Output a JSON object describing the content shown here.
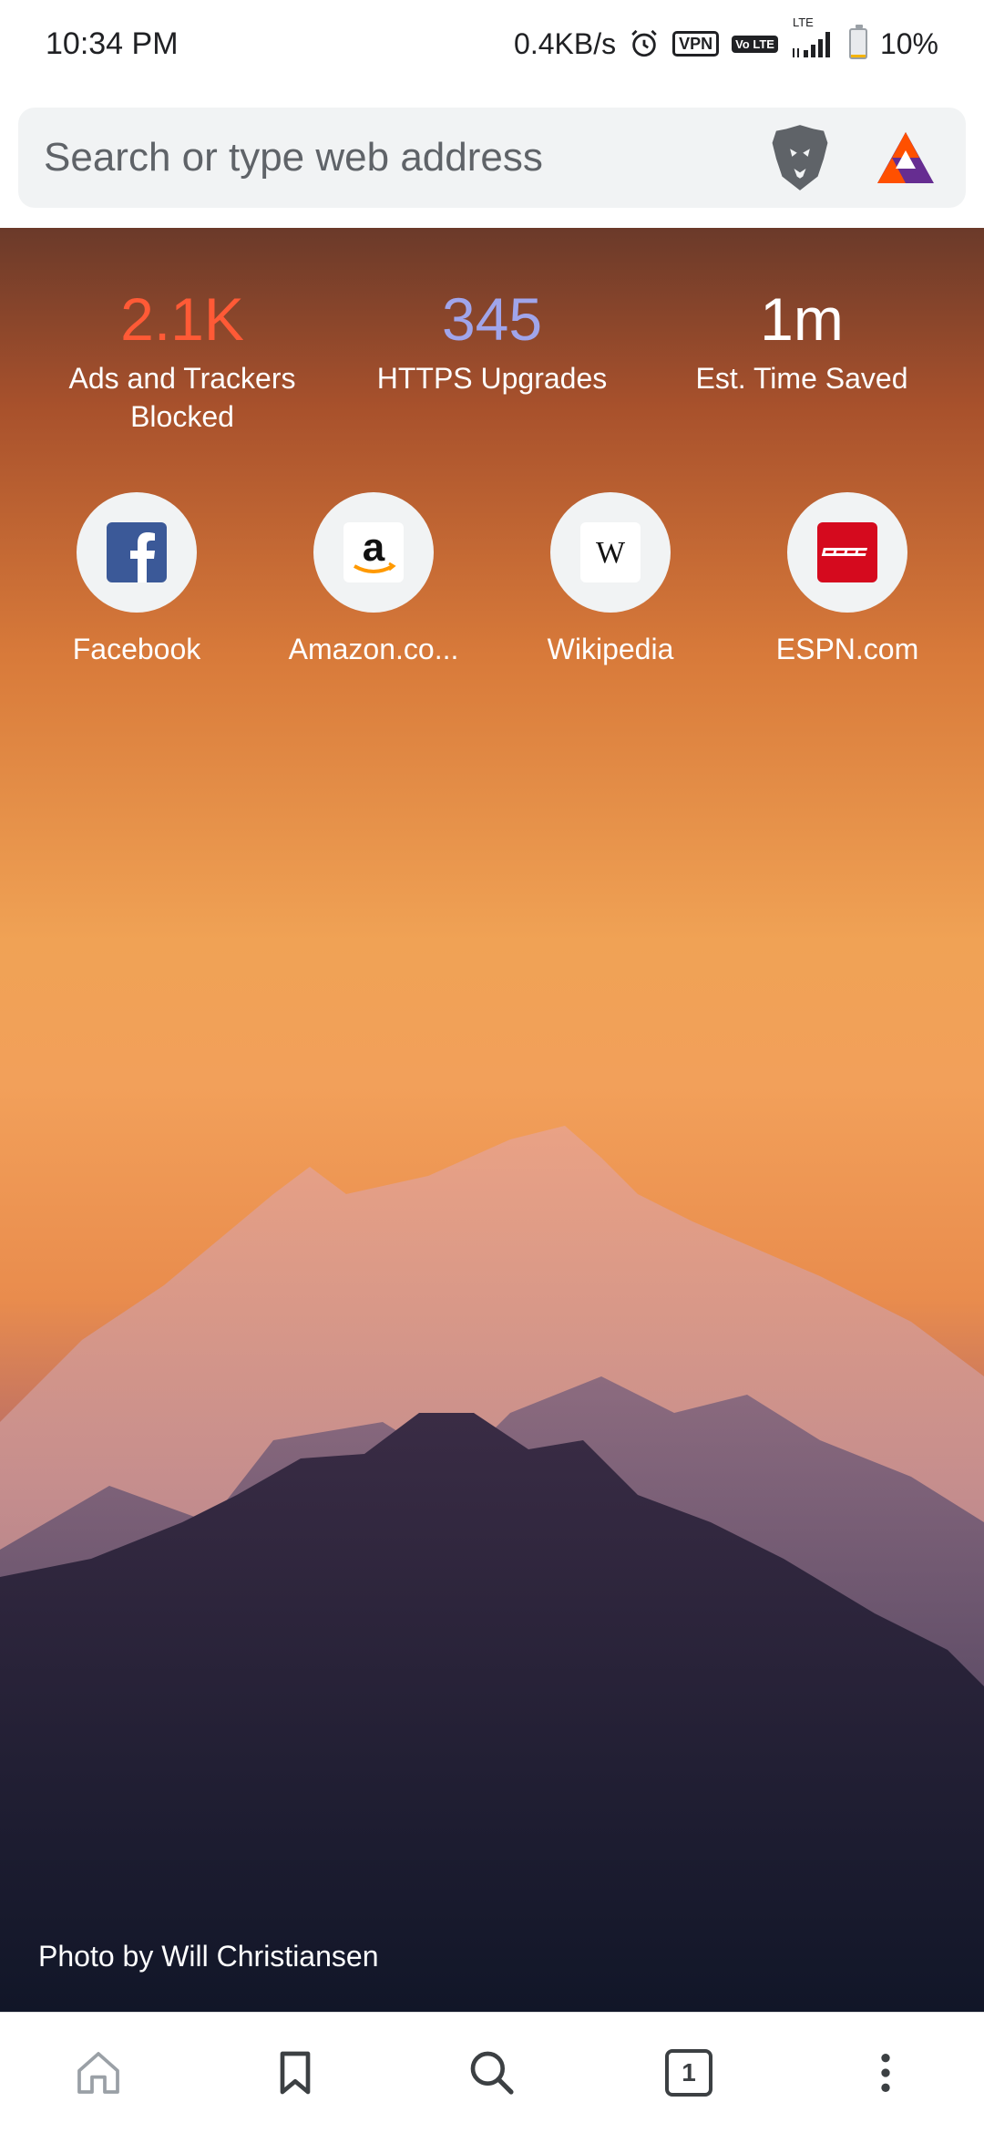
{
  "status_bar": {
    "time": "10:34 PM",
    "network_speed": "0.4KB/s",
    "vpn_label": "VPN",
    "volte_label": "Vo LTE",
    "lte_label": "LTE",
    "battery_percent": "10%",
    "battery_level": 0.1
  },
  "search": {
    "placeholder": "Search or type web address"
  },
  "stats": [
    {
      "value": "2.1K",
      "label": "Ads and Trackers Blocked",
      "color": "#ff5a36"
    },
    {
      "value": "345",
      "label": "HTTPS Upgrades",
      "color": "#a0a5eb"
    },
    {
      "value": "1m",
      "label": "Est. Time Saved",
      "color": "#ffffff"
    }
  ],
  "top_sites": [
    {
      "label": "Facebook",
      "icon": "facebook-icon"
    },
    {
      "label": "Amazon.co...",
      "icon": "amazon-icon"
    },
    {
      "label": "Wikipedia",
      "icon": "wikipedia-icon"
    },
    {
      "label": "ESPN.com",
      "icon": "espn-icon"
    }
  ],
  "photo_credit": "Photo by Will Christiansen",
  "bottom_nav": {
    "tab_count": "1",
    "items": [
      "home-icon",
      "bookmark-icon",
      "search-icon",
      "tab-switcher",
      "more-menu-icon"
    ]
  },
  "colors": {
    "brand_orange": "#fb542b",
    "bat_purple": "#662d91",
    "icon_gray": "#3c4043"
  }
}
